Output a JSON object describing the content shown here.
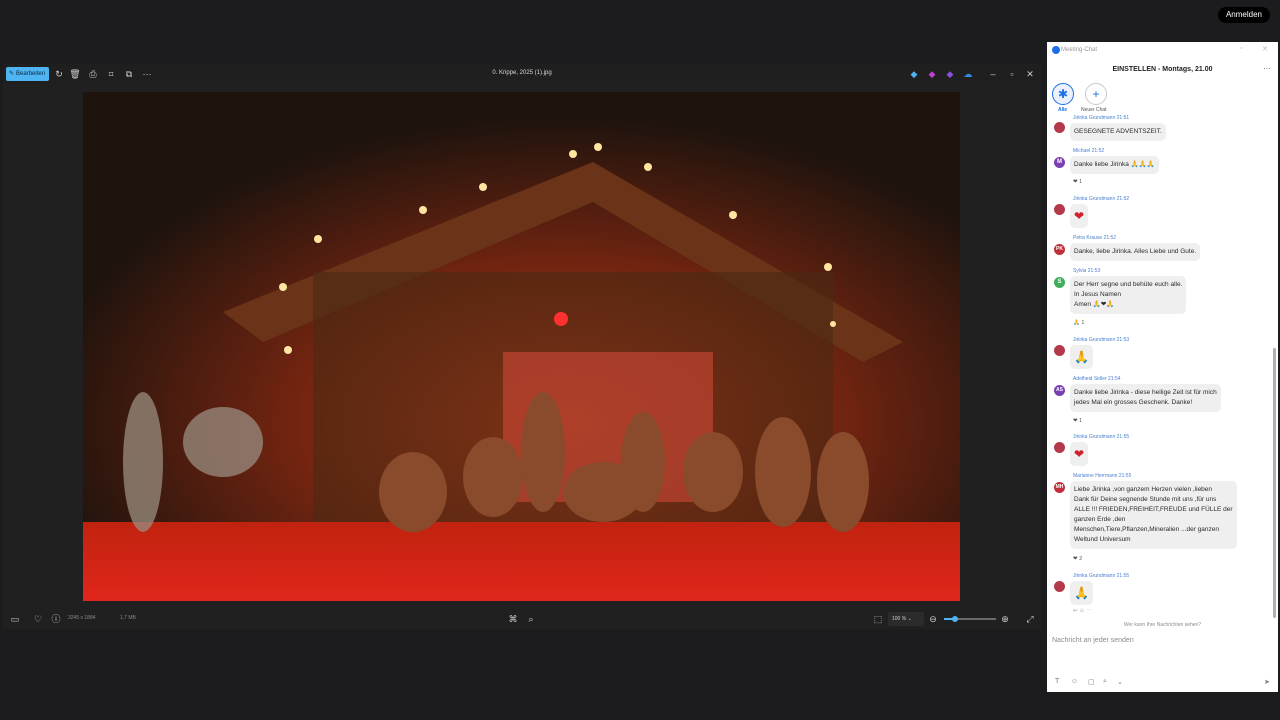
{
  "topbar": {
    "signin_label": "Anmelden"
  },
  "viewer": {
    "edit_label": "Bearbeiten",
    "file_title": "0. Krippe, 2025 (1).jpg",
    "dimensions": "3245 x 1884",
    "filesize": "1,7 MB",
    "zoom": "100 %"
  },
  "chat": {
    "window_title": "Meeting-Chat",
    "header": "EINSTELLEN - Montags, 21.00",
    "tab_all": "Alle",
    "tab_new": "Neuer Chat",
    "messages": [
      {
        "sender": "Jirinka Grundmann 21:51",
        "initials": "",
        "text": "GESEGNETE ADVENTSZEIT.",
        "reaction": ""
      },
      {
        "sender": "Michael 21:52",
        "initials": "M",
        "text": "Danke liebe Jirinka 🙏🙏🙏",
        "reaction": "❤ 1"
      },
      {
        "sender": "Jirinka Grundmann 21:52",
        "initials": "",
        "text": "❤",
        "reaction": ""
      },
      {
        "sender": "Petra Krause 21:52",
        "initials": "PK",
        "text": "Danke,  liebe Jirinka. Alles Liebe und Gute.",
        "reaction": ""
      },
      {
        "sender": "Sylvia 21:53",
        "initials": "S",
        "text": "Der Herr segne und behüte euch alle.\nIn Jesus Namen\nAmen 🙏❤🙏",
        "reaction": "🙏 1"
      },
      {
        "sender": "Jirinka Grundmann 21:53",
        "initials": "",
        "text": "🙏",
        "reaction": ""
      },
      {
        "sender": "Adelheid Sidler 21:54",
        "initials": "AS",
        "text": "Danke liebe Jirinka - diese heilige Zeit ist für mich\njedes Mal ein grosses Geschenk. Danke!",
        "reaction": "❤ 1"
      },
      {
        "sender": "Jirinka Grundmann 21:55",
        "initials": "",
        "text": "❤",
        "reaction": ""
      },
      {
        "sender": "Marianne Herrmann 21:55",
        "initials": "MH",
        "text": "Liebe Jirinka ,von ganzem Herzen vielen ,lieben\nDank für Deine segnende Stunde mit uns ,für uns\nALLE !!! FRIEDEN,FREIHEIT,FREUDE und FÜLLE der\nganzen Erde ,den\nMenschen,Tiere,Pflanzen,Mineralien ...der ganzen\nWeltund Universum",
        "reaction": "❤ 2"
      },
      {
        "sender": "Jirinka Grundmann 21:55",
        "initials": "",
        "text": "🙏",
        "reaction": ""
      }
    ],
    "who_sees": "Wer kann Ihre Nachrichten sehen?",
    "compose_placeholder": "Nachricht an jeder senden"
  }
}
